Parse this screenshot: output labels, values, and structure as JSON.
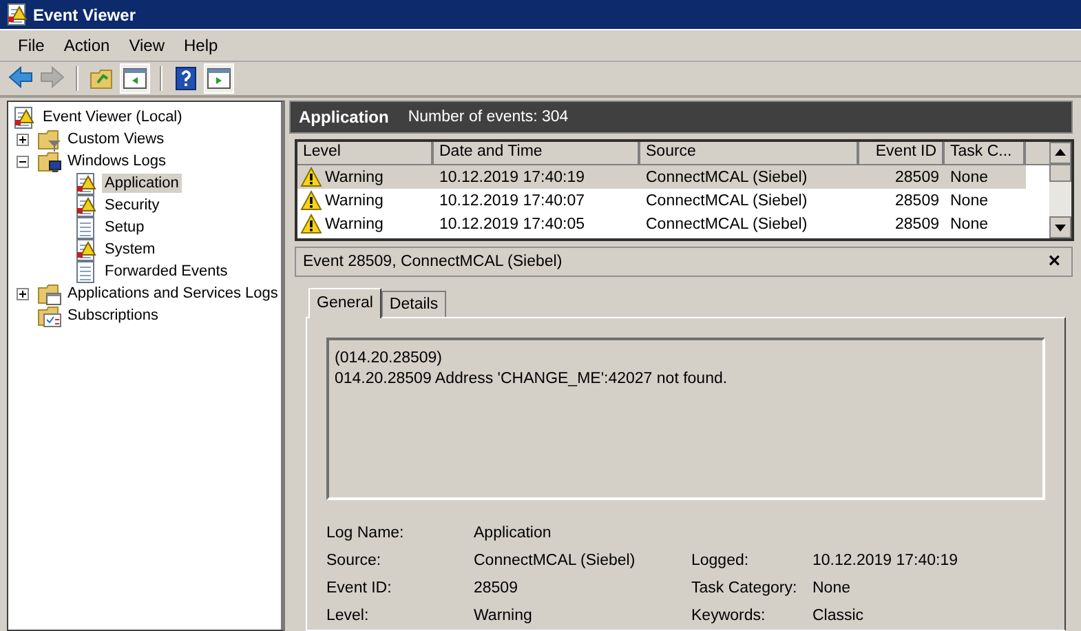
{
  "window": {
    "title": "Event Viewer"
  },
  "menu": [
    "File",
    "Action",
    "View",
    "Help"
  ],
  "toolbar": [
    {
      "kind": "back",
      "disabled": false
    },
    {
      "kind": "forward",
      "disabled": true
    },
    {
      "kind": "sep"
    },
    {
      "kind": "up-folder",
      "disabled": false
    },
    {
      "kind": "hide-tree",
      "disabled": false
    },
    {
      "kind": "sep"
    },
    {
      "kind": "help",
      "disabled": false
    },
    {
      "kind": "show-action",
      "disabled": false
    }
  ],
  "tree": [
    {
      "label": "Event Viewer (Local)",
      "kind": "root",
      "selected": false,
      "children": [
        {
          "label": "Custom Views",
          "kind": "filter-folder",
          "selected": false,
          "expanded": false
        },
        {
          "label": "Windows Logs",
          "kind": "computer-folder",
          "selected": false,
          "expanded": true,
          "children": [
            {
              "label": "Application",
              "kind": "alert-log",
              "selected": true
            },
            {
              "label": "Security",
              "kind": "alert-log",
              "selected": false
            },
            {
              "label": "Setup",
              "kind": "log",
              "selected": false
            },
            {
              "label": "System",
              "kind": "alert-log",
              "selected": false
            },
            {
              "label": "Forwarded Events",
              "kind": "log",
              "selected": false
            }
          ]
        },
        {
          "label": "Applications and Services Logs",
          "kind": "window-folder",
          "selected": false,
          "expanded": false
        },
        {
          "label": "Subscriptions",
          "kind": "subscriptions",
          "selected": false
        }
      ]
    }
  ],
  "header": {
    "title": "Application",
    "info": "Number of events: 304"
  },
  "table": {
    "columns": [
      {
        "label": "Level"
      },
      {
        "label": "Date and Time"
      },
      {
        "label": "Source"
      },
      {
        "label": "Event ID"
      },
      {
        "label": "Task C..."
      }
    ],
    "rows": [
      {
        "level": "Warning",
        "kind": "warning",
        "date": "10.12.2019 17:40:19",
        "source": "ConnectMCAL (Siebel)",
        "event_id": "28509",
        "task": "None",
        "selected": true
      },
      {
        "level": "Warning",
        "kind": "warning",
        "date": "10.12.2019 17:40:07",
        "source": "ConnectMCAL (Siebel)",
        "event_id": "28509",
        "task": "None",
        "selected": false
      },
      {
        "level": "Warning",
        "kind": "warning",
        "date": "10.12.2019 17:40:05",
        "source": "ConnectMCAL (Siebel)",
        "event_id": "28509",
        "task": "None",
        "selected": false
      }
    ]
  },
  "detail": {
    "title": "Event 28509, ConnectMCAL (Siebel)",
    "close": "×",
    "tabs": [
      {
        "label": "General",
        "selected": true
      },
      {
        "label": "Details",
        "selected": false
      }
    ],
    "message": [
      "(014.20.28509)",
      "014.20.28509 Address 'CHANGE_ME':42027 not found."
    ],
    "fields": [
      [
        {
          "label": "Log Name:",
          "value": "Application"
        }
      ],
      [
        {
          "label": "Source:",
          "value": "ConnectMCAL (Siebel)"
        },
        {
          "label": "Logged:",
          "value": "10.12.2019 17:40:19"
        }
      ],
      [
        {
          "label": "Event ID:",
          "value": "28509"
        },
        {
          "label": "Task Category:",
          "value": "None"
        }
      ],
      [
        {
          "label": "Level:",
          "value": "Warning"
        },
        {
          "label": "Keywords:",
          "value": "Classic"
        }
      ]
    ]
  }
}
